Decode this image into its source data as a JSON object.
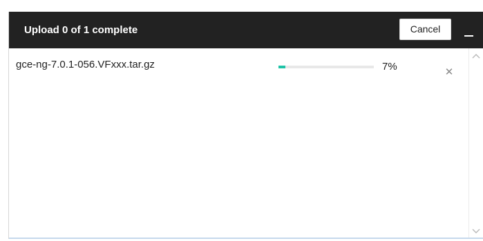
{
  "upload_panel": {
    "title": "Upload 0 of 1 complete",
    "cancel_label": "Cancel",
    "files": [
      {
        "name": "gce-ng-7.0.1-056.VFxxx.tar.gz",
        "progress_percent": 7,
        "progress_text": "7%"
      }
    ]
  },
  "colors": {
    "header_background": "#222222",
    "progress_fill": "#1fc3a7",
    "progress_track": "#e8e8e8"
  },
  "icons": {
    "minimize": "minimize-icon",
    "remove": "close-icon",
    "scroll_up": "chevron-up-icon",
    "scroll_down": "chevron-down-icon"
  }
}
